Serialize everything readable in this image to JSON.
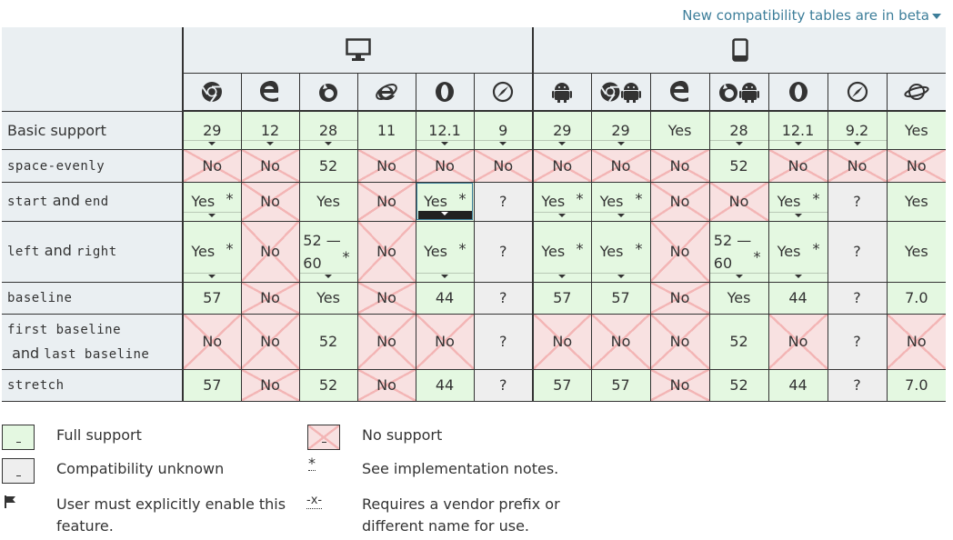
{
  "beta_link": "New compatibility tables are in beta",
  "browsers": [
    {
      "name": "chrome-icon",
      "desktop": true
    },
    {
      "name": "edge-icon",
      "desktop": true
    },
    {
      "name": "firefox-icon",
      "desktop": true
    },
    {
      "name": "ie-icon",
      "desktop": true
    },
    {
      "name": "opera-icon",
      "desktop": true
    },
    {
      "name": "safari-icon",
      "desktop": true
    },
    {
      "name": "android-webview-icon",
      "desktop": false
    },
    {
      "name": "chrome-android-icon",
      "desktop": false
    },
    {
      "name": "edge-mobile-icon",
      "desktop": false
    },
    {
      "name": "firefox-android-icon",
      "desktop": false
    },
    {
      "name": "opera-android-icon",
      "desktop": false
    },
    {
      "name": "safari-ios-icon",
      "desktop": false
    },
    {
      "name": "samsung-internet-icon",
      "desktop": false
    }
  ],
  "features": {
    "basic": {
      "label": "Basic support"
    },
    "space_evenly": {
      "code": "space-evenly"
    },
    "start_end": {
      "code1": "start",
      "mid": " and ",
      "code2": "end"
    },
    "left_right": {
      "code1": "left",
      "mid": " and ",
      "code2": "right"
    },
    "baseline": {
      "code": "baseline"
    },
    "first_last": {
      "code1": "first baseline",
      "mid": " and ",
      "code2": "last baseline"
    },
    "stretch": {
      "code": "stretch"
    }
  },
  "rows": {
    "basic": [
      "29",
      "12",
      "28",
      "11",
      "12.1",
      "9",
      "29",
      "29",
      "Yes",
      "28",
      "12.1",
      "9.2",
      "Yes"
    ],
    "space_evenly": [
      "No",
      "No",
      "52",
      "No",
      "No",
      "No",
      "No",
      "No",
      "No",
      "52",
      "No",
      "No",
      "No"
    ],
    "start_end": [
      "Yes",
      "No",
      "Yes",
      "No",
      "Yes",
      "?",
      "Yes",
      "Yes",
      "No",
      "No",
      "Yes",
      "?",
      "Yes"
    ],
    "left_right_val": [
      "Yes",
      "No",
      "52 — 60",
      "No",
      "Yes",
      "?",
      "Yes",
      "Yes",
      "No",
      "52 — 60",
      "Yes",
      "?",
      "Yes"
    ],
    "baseline": [
      "57",
      "No",
      "Yes",
      "No",
      "44",
      "?",
      "57",
      "57",
      "No",
      "Yes",
      "44",
      "?",
      "7.0"
    ],
    "first_last": [
      "No",
      "No",
      "52",
      "No",
      "No",
      "?",
      "No",
      "No",
      "No",
      "52",
      "No",
      "?",
      "No"
    ],
    "stretch": [
      "57",
      "No",
      "52",
      "No",
      "44",
      "?",
      "57",
      "57",
      "No",
      "52",
      "44",
      "?",
      "7.0"
    ]
  },
  "star": "*",
  "legend": {
    "full": "Full support",
    "none": "No support",
    "unknown": "Compatibility unknown",
    "notes_mark": "*",
    "notes": "See implementation notes.",
    "flag": "User must explicitly enable this feature.",
    "prefix_mark": "-x-",
    "prefix": "Requires a vendor prefix or different name for use."
  },
  "colors": {
    "yes": "#e4f8e1",
    "no": "#f8e1e1",
    "unknown": "#eeeeee",
    "header": "#eaeff2",
    "link": "#3d7e9a"
  }
}
